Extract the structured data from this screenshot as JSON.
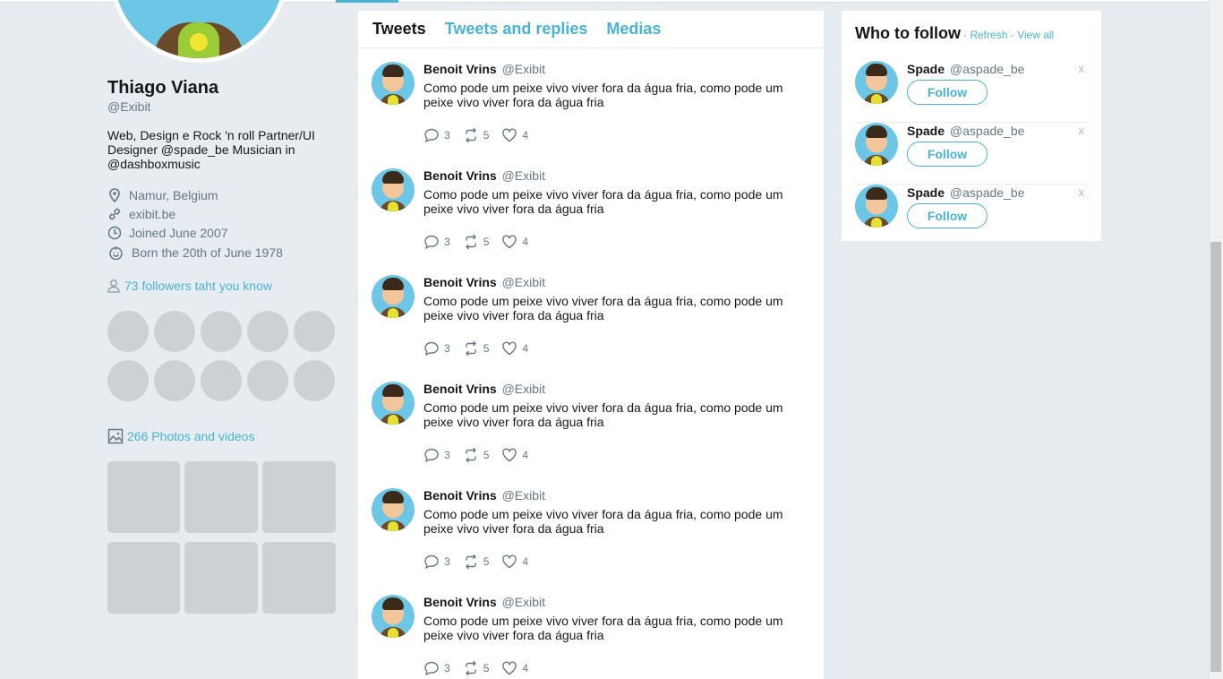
{
  "profile": {
    "name": "Thiago Viana",
    "handle": "@Exibit",
    "bio": "Web, Design e Rock 'n roll Partner/UI Designer @spade_be Musician in @dashboxmusic",
    "location": "Namur, Belgium",
    "website": "exibit.be",
    "joined": "Joined June 2007",
    "born": "Born the 20th of June 1978",
    "followers_you_know": "73 followers taht you know",
    "photos_videos": "266 Photos and videos"
  },
  "tabs": [
    {
      "label": "Tweets",
      "active": true
    },
    {
      "label": "Tweets and replies",
      "active": false
    },
    {
      "label": "Medias",
      "active": false
    }
  ],
  "tweets": [
    {
      "name": "Benoit Vrins",
      "handle": "@Exibit",
      "text": "Como pode um peixe vivo viver fora da água fria, como pode um peixe vivo viver fora da água fria",
      "replies": "3",
      "retweets": "5",
      "likes": "4"
    },
    {
      "name": "Benoit Vrins",
      "handle": "@Exibit",
      "text": "Como pode um peixe vivo viver fora da água fria, como pode um peixe vivo viver fora da água fria",
      "replies": "3",
      "retweets": "5",
      "likes": "4"
    },
    {
      "name": "Benoit Vrins",
      "handle": "@Exibit",
      "text": "Como pode um peixe vivo viver fora da água fria, como pode um peixe vivo viver fora da água fria",
      "replies": "3",
      "retweets": "5",
      "likes": "4"
    },
    {
      "name": "Benoit Vrins",
      "handle": "@Exibit",
      "text": "Como pode um peixe vivo viver fora da água fria, como pode um peixe vivo viver fora da água fria",
      "replies": "3",
      "retweets": "5",
      "likes": "4"
    },
    {
      "name": "Benoit Vrins",
      "handle": "@Exibit",
      "text": "Como pode um peixe vivo viver fora da água fria, como pode um peixe vivo viver fora da água fria",
      "replies": "3",
      "retweets": "5",
      "likes": "4"
    },
    {
      "name": "Benoit Vrins",
      "handle": "@Exibit",
      "text": "Como pode um peixe vivo viver fora da água fria, como pode um peixe vivo viver fora da água fria",
      "replies": "3",
      "retweets": "5",
      "likes": "4"
    }
  ],
  "who_to_follow": {
    "title": "Who to follow",
    "separator": "·",
    "refresh": "Refresh",
    "view_all": "View all",
    "items": [
      {
        "name": "Spade",
        "handle": "@aspade_be",
        "button": "Follow",
        "close": "x"
      },
      {
        "name": "Spade",
        "handle": "@aspade_be",
        "button": "Follow",
        "close": "x"
      },
      {
        "name": "Spade",
        "handle": "@aspade_be",
        "button": "Follow",
        "close": "x"
      }
    ]
  },
  "colors": {
    "accent": "#4ab3d4",
    "background": "#e6ecf0",
    "muted": "#657786",
    "placeholder": "#ccd1d5"
  },
  "icons": [
    "location-icon",
    "link-icon",
    "clock-icon",
    "birthday-icon",
    "user-icon",
    "image-icon",
    "reply-icon",
    "retweet-icon",
    "heart-icon"
  ]
}
